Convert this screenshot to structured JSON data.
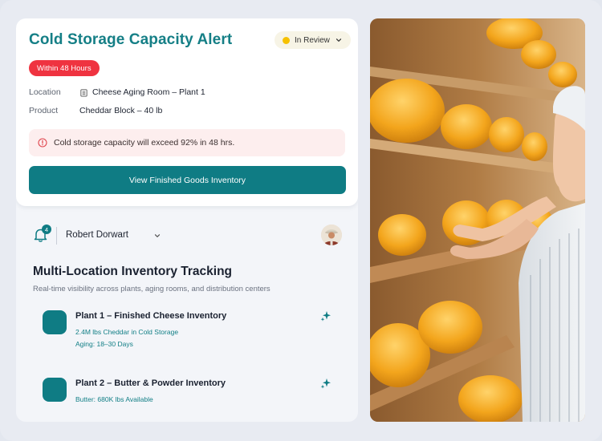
{
  "alert": {
    "title": "Cold Storage Capacity Alert",
    "status": "In Review",
    "urgency": "Within 48 Hours",
    "location_label": "Location",
    "location_value": "Cheese Aging Room – Plant 1",
    "product_label": "Product",
    "product_value": "Cheddar Block – 40 lb",
    "warning": "Cold storage capacity will exceed 92% in 48 hrs.",
    "cta": "View Finished Goods Inventory"
  },
  "user": {
    "notifications": "4",
    "name": "Robert Dorwart"
  },
  "section": {
    "title": "Multi-Location Inventory Tracking",
    "subtitle": "Real-time visibility across plants, aging rooms, and distribution centers"
  },
  "locations": [
    {
      "title": "Plant 1 – Finished Cheese Inventory",
      "line1": "2.4M lbs Cheddar in Cold Storage",
      "line2": "Aging: 18–30 Days"
    },
    {
      "title": "Plant 2 – Butter & Powder Inventory",
      "line1": "Butter: 680K lbs Available"
    }
  ],
  "colors": {
    "accent": "#0f7c84",
    "title_teal": "#157f86",
    "urgent_red": "#ef3340",
    "warning_bg": "#fdeeee",
    "status_yellow": "#f6c100"
  },
  "icons": [
    "chevron-down-icon",
    "building-icon",
    "alert-circle-icon",
    "bell-icon",
    "sparkle-icon"
  ]
}
